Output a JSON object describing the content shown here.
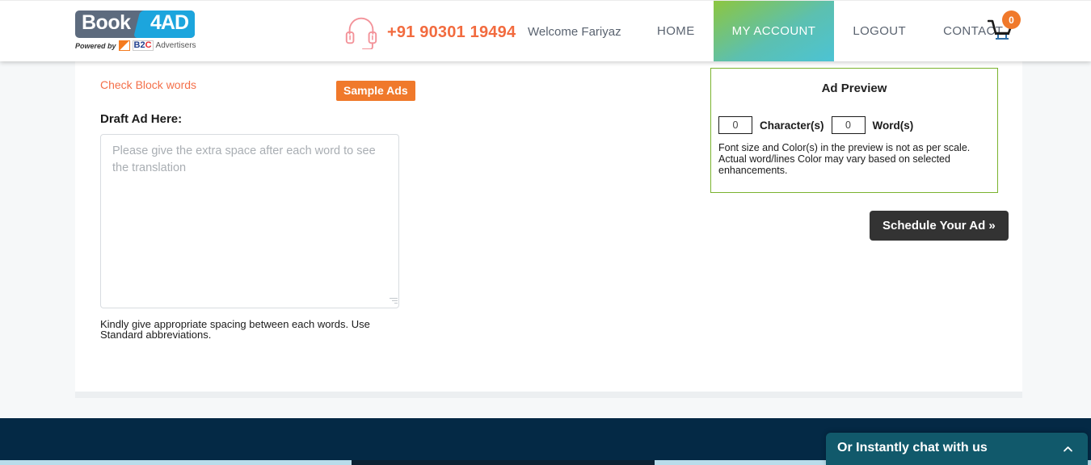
{
  "header": {
    "logo": {
      "word_main": "Book",
      "word_accent": "4AD",
      "powered_by": "Powered by",
      "brand_b2": "B2",
      "brand_c": "C",
      "brand_advertisers": "Advertisers"
    },
    "headset_icon": "headset-icon",
    "phone": "+91 90301 19494",
    "welcome": "Welcome Fariyaz",
    "nav": [
      {
        "label": "HOME",
        "active": false
      },
      {
        "label": "MY ACCOUNT",
        "active": true
      },
      {
        "label": "LOGOUT",
        "active": false
      },
      {
        "label": "CONTACT",
        "active": false
      }
    ],
    "cart": {
      "icon": "shopping-cart-icon",
      "count": "0"
    },
    "active_accent_start": "#8dc63f",
    "active_accent_end": "#4cc3d4"
  },
  "main": {
    "check_block_words": "Check Block words",
    "sample_ads_label": "Sample Ads",
    "draft_label": "Draft Ad Here:",
    "draft_value": "",
    "draft_placeholder": "Please give the extra space after each word to see the translation",
    "helper_line1": "Kindly give appropriate spacing between each words. Use",
    "helper_line2": "Standard abbreviations.",
    "link_color": "#f4704a",
    "sample_btn_color": "#f0792b"
  },
  "ad_preview": {
    "title": "Ad Preview",
    "character_count": "0",
    "character_label": "Character(s)",
    "word_count": "0",
    "word_label": "Word(s)",
    "note_line1": "Font size and Color(s) in the preview is not as per scale.",
    "note_line2": "Actual word/lines Color may vary based on selected",
    "note_line3": "enhancements.",
    "border_color": "#7ab32e"
  },
  "actions": {
    "schedule_label": "Schedule Your Ad »",
    "schedule_bg": "#333333"
  },
  "footer": {
    "bg_color": "#042945"
  },
  "chat": {
    "title": "Or Instantly chat with us",
    "chevron_icon": "chevron-up-icon",
    "bg_color": "#11596b"
  }
}
